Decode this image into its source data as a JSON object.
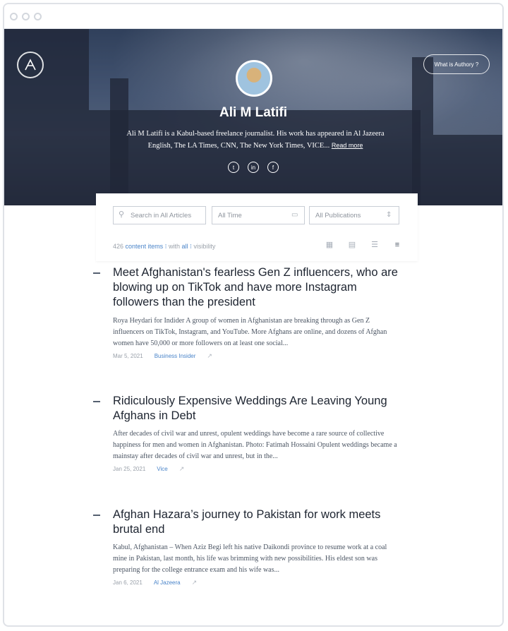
{
  "profile": {
    "name": "Ali M Latifi",
    "bio": "Ali M Latifi is a Kabul-based freelance journalist. His work has appeared in Al Jazeera English, The LA Times, CNN, The New York Times, VICE...",
    "read_more": "Read more",
    "cta": "What is Authory ?"
  },
  "socials": [
    {
      "name": "twitter-icon",
      "glyph": "t"
    },
    {
      "name": "linkedin-icon",
      "glyph": "in"
    },
    {
      "name": "facebook-icon",
      "glyph": "f"
    }
  ],
  "filters": {
    "search_placeholder": "Search in All Articles",
    "time_value": "All Time",
    "publication_value": "All Publications",
    "count": "426",
    "content_items": "content items",
    "with_label": "with",
    "visibility_value": "all",
    "visibility_label": "visibility"
  },
  "articles": [
    {
      "title": "Meet Afghanistan's fearless Gen Z influencers, who are blowing up on TikTok and have more Instagram followers than the president",
      "excerpt": "Roya Heydari for Indider A group of women in Afghanistan are breaking through as Gen Z influencers on TikTok, Instagram, and YouTube. More Afghans are online, and dozens of Afghan women have 50,000 or more followers on at least one social...",
      "date": "Mar 5, 2021",
      "publication": "Business Insider"
    },
    {
      "title": "Ridiculously Expensive Weddings Are Leaving Young Afghans in Debt",
      "excerpt": "After decades of civil war and unrest, opulent weddings have become a rare source of collective happiness for men and women in Afghanistan. Photo: Fatimah Hossaini Opulent weddings became a mainstay after decades of civil war and unrest, but in the...",
      "date": "Jan 25, 2021",
      "publication": "Vice"
    },
    {
      "title": "Afghan Hazara’s journey to Pakistan for work meets brutal end",
      "excerpt": "Kabul, Afghanistan – When Aziz Begi left his native Daikondi province to resume work at a coal mine in Pakistan, last month, his life was brimming with new possibilities. His eldest son was preparing for the college entrance exam and his wife was...",
      "date": "Jan 6, 2021",
      "publication": "Al Jazeera"
    }
  ]
}
